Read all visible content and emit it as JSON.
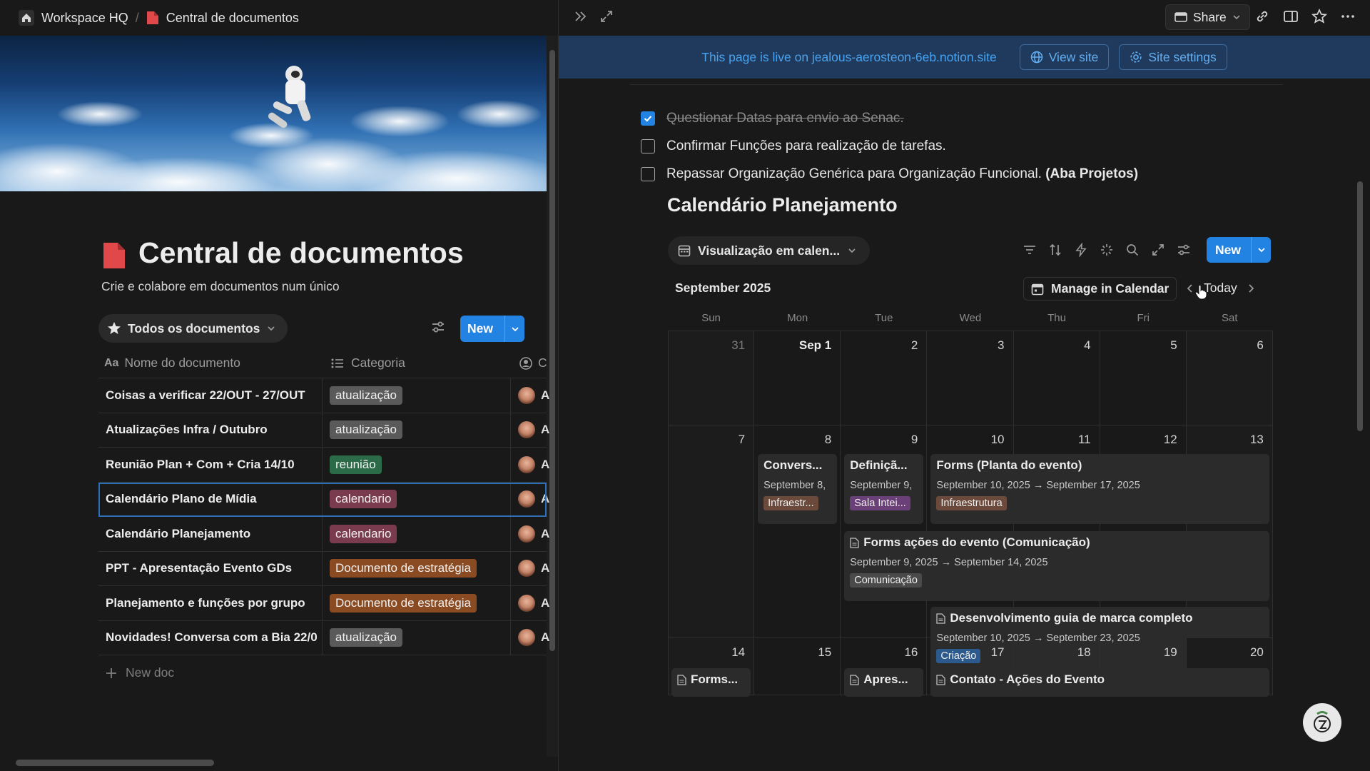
{
  "left_pane": {
    "breadcrumb": {
      "workspace": "Workspace HQ",
      "separator": "/",
      "page": "Central de documentos"
    },
    "page_title": "Central de documentos",
    "page_description": "Crie e colabore em documentos num único",
    "view_tab_label": "Todos os documentos",
    "new_button_label": "New",
    "columns": {
      "name": "Nome do documento",
      "category": "Categoria",
      "created_by": "C"
    },
    "rows": [
      {
        "name": "Coisas a verificar 22/OUT - 27/OUT",
        "category": "atualização",
        "category_color": "#5a5a5a",
        "owner_initial": "A"
      },
      {
        "name": "Atualizações Infra / Outubro",
        "category": "atualização",
        "category_color": "#5a5a5a",
        "owner_initial": "A"
      },
      {
        "name": "Reunião Plan + Com + Cria 14/10",
        "category": "reunião",
        "category_color": "#2b6b47",
        "owner_initial": "A"
      },
      {
        "name": "Calendário Plano de Mídia",
        "category": "calendario",
        "category_color": "#7b3b4f",
        "owner_initial": "A"
      },
      {
        "name": "Calendário Planejamento",
        "category": "calendario",
        "category_color": "#7b3b4f",
        "owner_initial": "A"
      },
      {
        "name": "PPT - Apresentação Evento GDs",
        "category": "Documento de estratégia",
        "category_color": "#8a4b22",
        "owner_initial": "A"
      },
      {
        "name": "Planejamento e funções por grupo",
        "category": "Documento de estratégia",
        "category_color": "#8a4b22",
        "owner_initial": "A"
      },
      {
        "name": "Novidades! Conversa com a Bia 22/0",
        "category": "atualização",
        "category_color": "#5a5a5a",
        "owner_initial": "A"
      }
    ],
    "new_doc_label": "New doc"
  },
  "right_pane": {
    "share_label": "Share",
    "banner": {
      "text": "This page is live on jealous-aerosteon-6eb.notion.site",
      "view_site_label": "View site",
      "site_settings_label": "Site settings"
    },
    "todos": [
      {
        "label": "Questionar Datas para envio ao Senac.",
        "bold_suffix": "",
        "checked": true
      },
      {
        "label": "Confirmar Funções para realização de tarefas.",
        "bold_suffix": "",
        "checked": false
      },
      {
        "label": "Repassar Organização Genérica para Organização Funcional. ",
        "bold_suffix": "(Aba Projetos)",
        "checked": false
      }
    ],
    "calendar": {
      "title": "Calendário Planejamento",
      "view_label": "Visualização em calen...",
      "new_label": "New",
      "month_label": "September 2025",
      "manage_label": "Manage in Calendar",
      "today_label": "Today",
      "weekdays": [
        "Sun",
        "Mon",
        "Tue",
        "Wed",
        "Thu",
        "Fri",
        "Sat"
      ],
      "weeks": [
        [
          "31",
          "Sep 1",
          "2",
          "3",
          "4",
          "5",
          "6"
        ],
        [
          "7",
          "8",
          "9",
          "10",
          "11",
          "12",
          "13"
        ],
        [
          "14",
          "15",
          "16",
          "17",
          "18",
          "19",
          "20"
        ]
      ],
      "events": [
        {
          "title": "Convers...",
          "dates": "September 8,",
          "tag": "Infraestr...",
          "tag_color": "#6b4a3c"
        },
        {
          "title": "Definiçã...",
          "dates": "September 9,",
          "tag": "Sala Intei...",
          "tag_color": "#6b3f78"
        },
        {
          "title": "Forms (Planta do evento)",
          "dates": "September 10, 2025 → September 17, 2025",
          "tag": "Infraestrutura",
          "tag_color": "#6b4a3c"
        },
        {
          "title": "Forms ações do evento (Comunicação)",
          "dates": "September 9, 2025 → September 14, 2025",
          "tag": "Comunicação",
          "tag_color": "#4a4a4a"
        },
        {
          "title": "Desenvolvimento guia de marca completo",
          "dates": "September 10, 2025 → September 23, 2025",
          "tag": "Criação",
          "tag_color": "#2d5a8c"
        },
        {
          "title": "Forms...",
          "dates": "",
          "tag": "",
          "tag_color": ""
        },
        {
          "title": "Apres...",
          "dates": "",
          "tag": "",
          "tag_color": ""
        },
        {
          "title": "Contato - Ações do Evento",
          "dates": "",
          "tag": "",
          "tag_color": ""
        }
      ]
    }
  }
}
